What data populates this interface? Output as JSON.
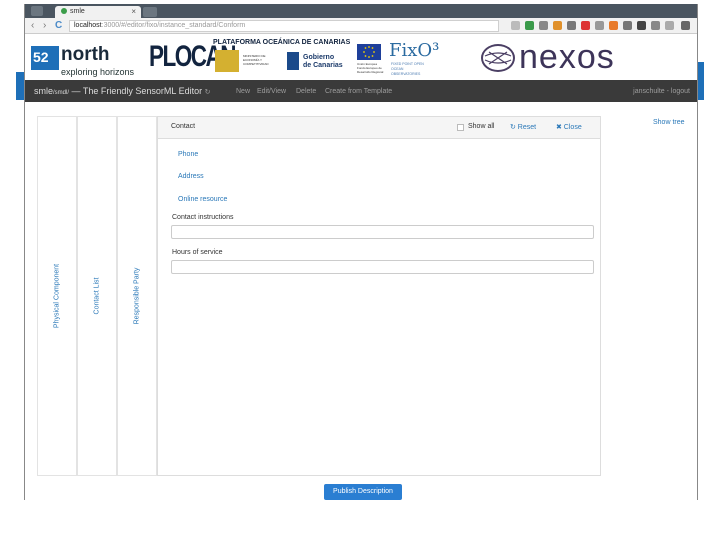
{
  "browser": {
    "tab_title": "smle",
    "tab_close": "×",
    "back_icon": "‹",
    "forward_icon": "›",
    "reload_icon": "C",
    "url_host": "localhost",
    "url_path": ":3000/#/editor/fixo/instance_standard/Conform"
  },
  "banner": {
    "logo_52north": {
      "box": "52",
      "word": "north",
      "tagline": "exploring horizons"
    },
    "logo_plocan": "PLOCAN",
    "plocan_text": "PLATAFORMA OCEÁNICA DE CANARIAS",
    "gov_spain_text": "MINISTERIO DE ECONOMÍA Y COMPETITIVIDAD",
    "canarias_text_1": "Gobierno",
    "canarias_text_2": "de Canarias",
    "eu_text": "Unión Europea Fondo Europeo de Desarrollo Regional",
    "logo_fixo": "FixO³",
    "fixo_text": "FIXED POINT OPEN OCEAN OBSERVATORIES",
    "logo_nexos": "nexos"
  },
  "navbar": {
    "brand": "smle",
    "brand_sub": "/smdl/",
    "brand_rest": " — The Friendly SensorML Editor",
    "refresh_icon": "↻",
    "links": [
      "New",
      "Edit/View",
      "Delete",
      "Create from Template"
    ],
    "user": "janschulte - logout"
  },
  "vtabs": [
    "Physical Component",
    "Contact List",
    "Responsible Party"
  ],
  "panel": {
    "title": "Contact",
    "show_all": "Show all",
    "reset": "↻ Reset",
    "close": "✖ Close",
    "links": [
      "Phone",
      "Address",
      "Online resource"
    ],
    "fields": [
      {
        "label": "Contact instructions",
        "value": ""
      },
      {
        "label": "Hours of service",
        "value": ""
      }
    ]
  },
  "show_tree": "Show tree",
  "publish": "Publish Description",
  "colors": {
    "accent": "#2a78b8",
    "navbar": "#3a3a3a",
    "publish": "#2a7ed2",
    "brand_blue": "#1e6fb8"
  }
}
